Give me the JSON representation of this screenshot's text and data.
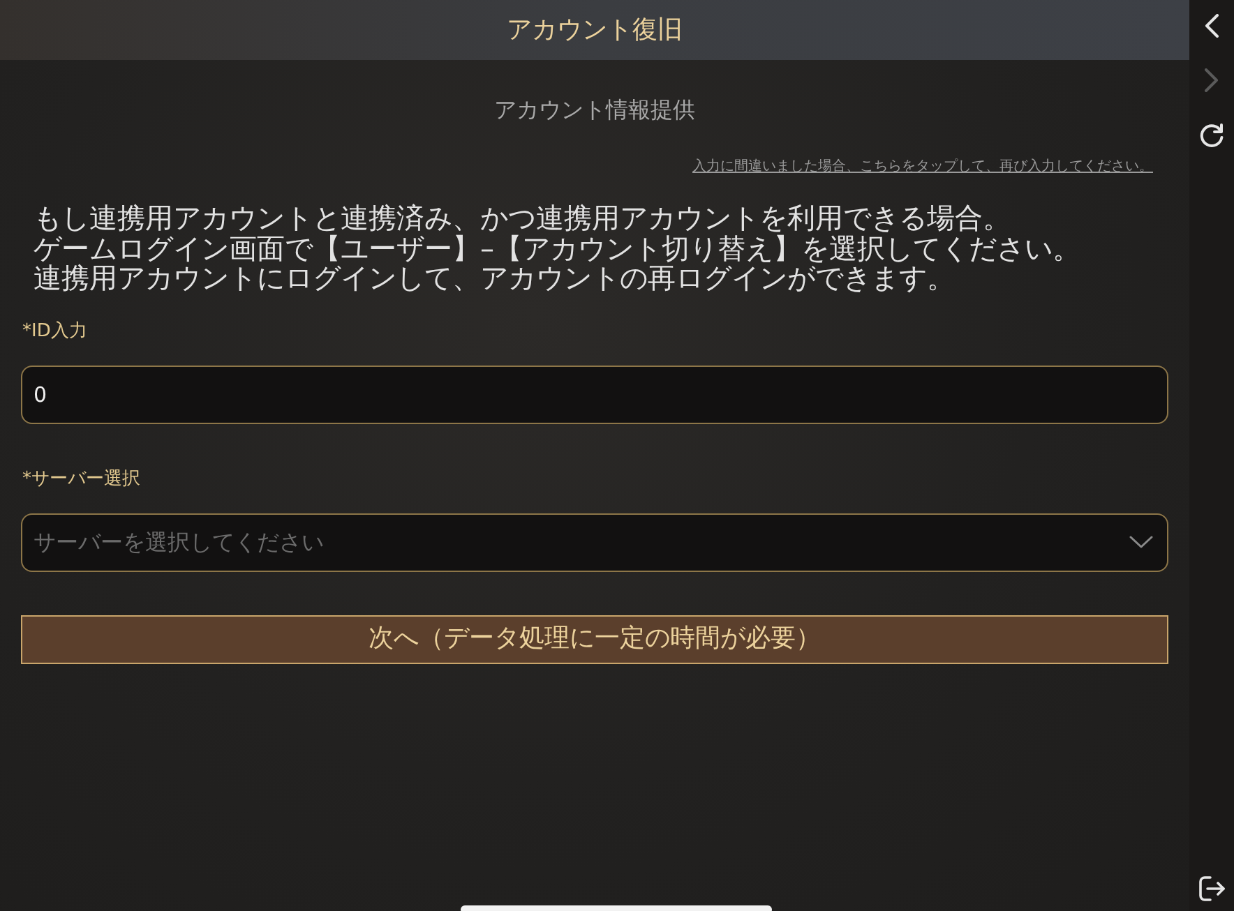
{
  "header": {
    "title": "アカウント復旧"
  },
  "page": {
    "subtitle": "アカウント情報提供",
    "retry_link": "入力に間違いました場合、こちらをタップして、再び入力してください。",
    "notice": [
      "もし連携用アカウントと連携済み、かつ連携用アカウントを利用できる場合。",
      "ゲームログイン画面で【ユーザー】–【アカウント切り替え】を選択してください。",
      "連携用アカウントにログインして、アカウントの再ログインができます。"
    ]
  },
  "form": {
    "fields": [
      {
        "kind": "input",
        "label": "*ID入力",
        "value": "0"
      },
      {
        "kind": "select",
        "label": "*サーバー選択",
        "placeholder": "サーバーを選択してください"
      }
    ],
    "submit_button": "次へ（データ処理に一定の時間が必要）"
  },
  "side_nav": {
    "top": [
      {
        "kind": "back",
        "disabled": false
      },
      {
        "kind": "forward",
        "disabled": true
      },
      {
        "kind": "reload",
        "disabled": false
      }
    ],
    "bottom": [
      {
        "kind": "logout",
        "disabled": false
      }
    ]
  }
}
